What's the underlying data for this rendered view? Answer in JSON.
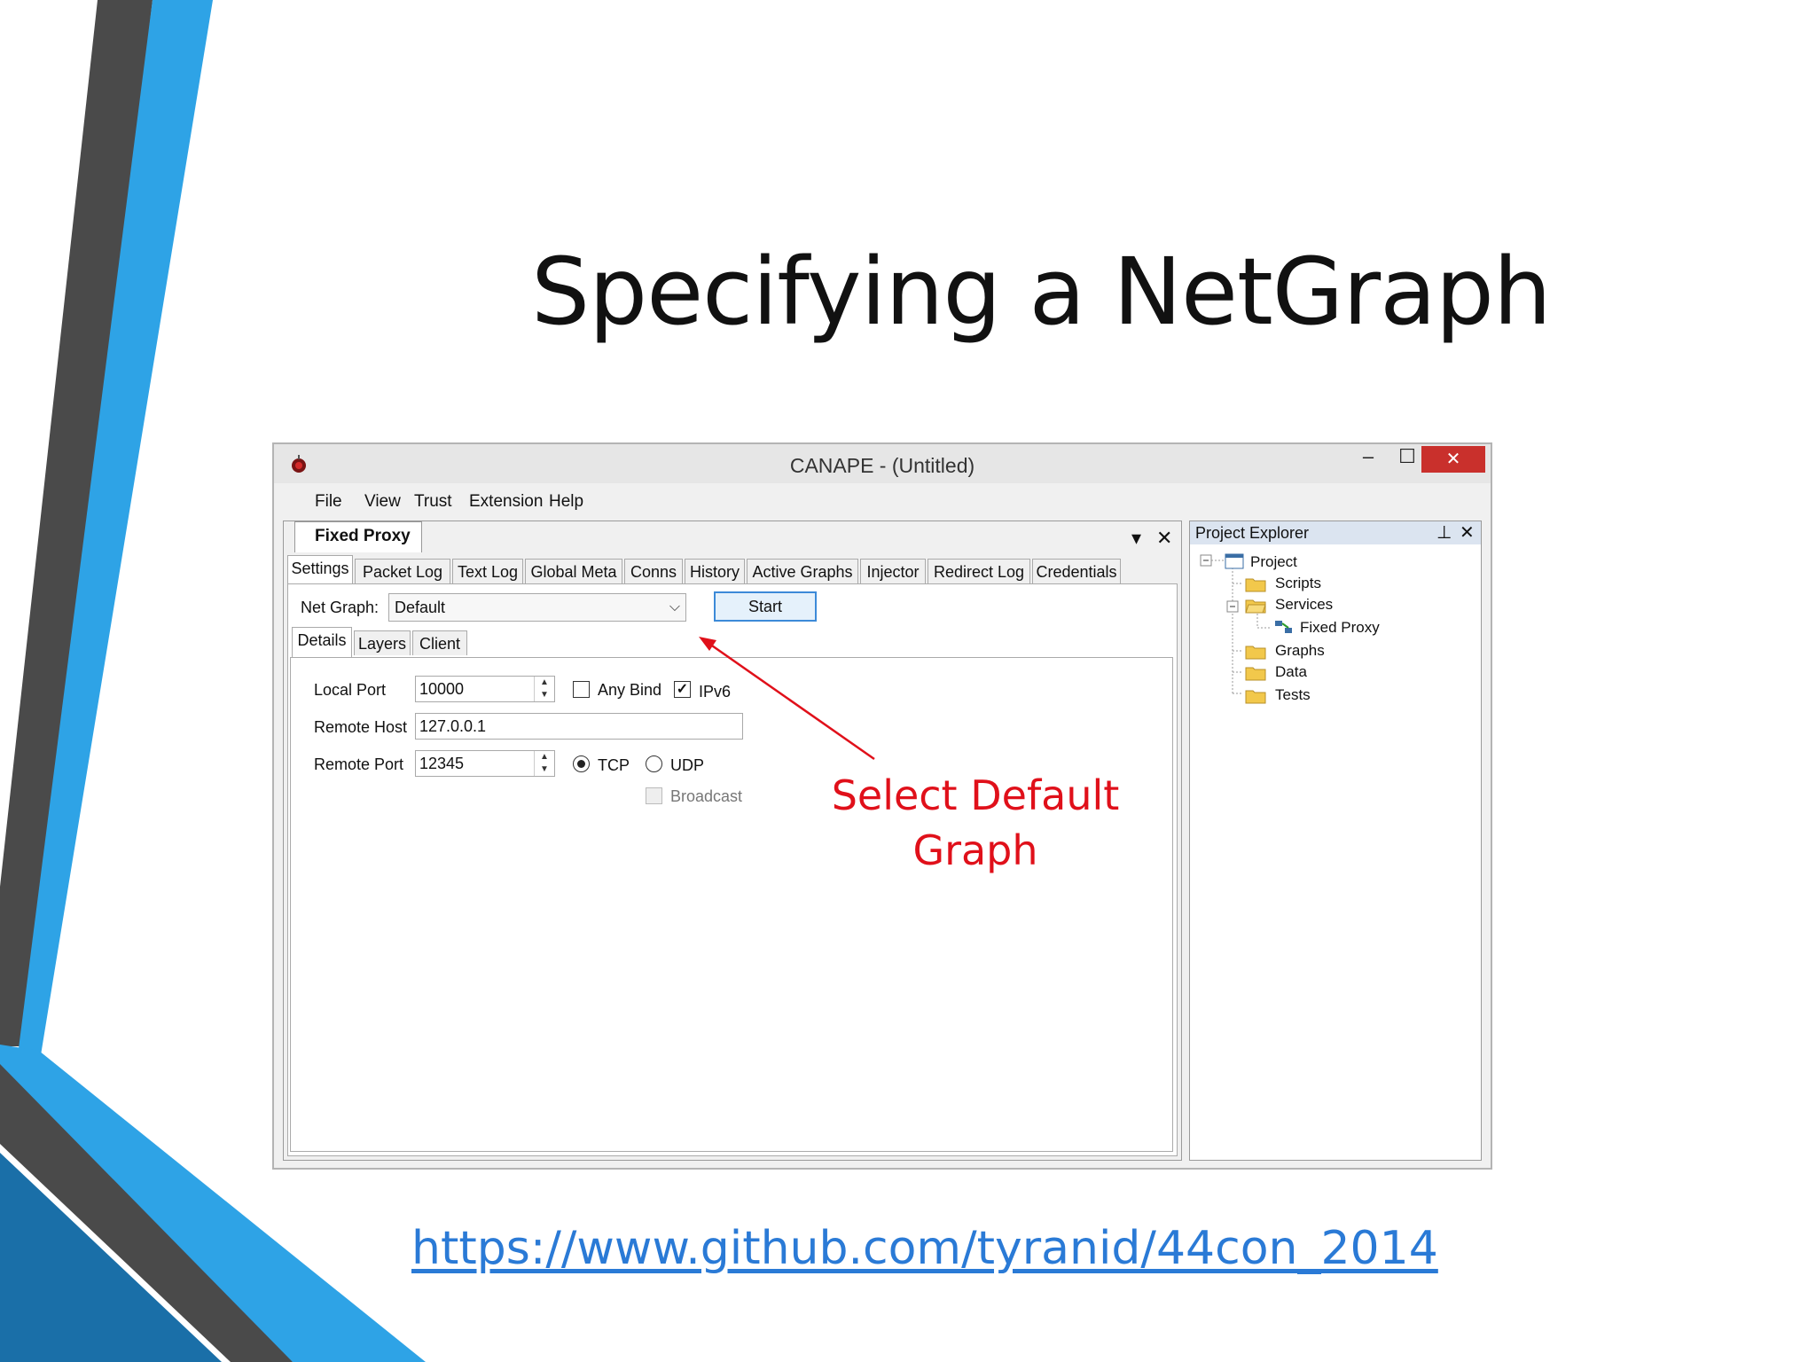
{
  "slide": {
    "title": "Specifying a NetGraph",
    "link": "https://www.github.com/tyranid/44con_2014",
    "annotation_line1": "Select Default",
    "annotation_line2": "Graph"
  },
  "window": {
    "title": "CANAPE - (Untitled)",
    "min_glyph": "–",
    "max_glyph": "☐",
    "close_glyph": "✕"
  },
  "menu": [
    "File",
    "View",
    "Trust",
    "Extension",
    "Help"
  ],
  "document": {
    "tab_label": "Fixed Proxy",
    "dropdown_glyph": "▾",
    "close_glyph": "✕",
    "tabs": [
      "Settings",
      "Packet Log",
      "Text Log",
      "Global Meta",
      "Conns",
      "History",
      "Active Graphs",
      "Injector",
      "Redirect Log",
      "Credentials"
    ],
    "net_graph_label": "Net Graph:",
    "net_graph_value": "Default",
    "start_label": "Start",
    "subtabs": [
      "Details",
      "Layers",
      "Client"
    ],
    "local_port_label": "Local Port",
    "local_port_value": "10000",
    "any_bind_label": "Any Bind",
    "ipv6_label": "IPv6",
    "remote_host_label": "Remote Host",
    "remote_host_value": "127.0.0.1",
    "remote_port_label": "Remote Port",
    "remote_port_value": "12345",
    "tcp_label": "TCP",
    "udp_label": "UDP",
    "broadcast_label": "Broadcast",
    "check_glyph": "✓"
  },
  "explorer": {
    "title": "Project Explorer",
    "pin_glyph": "⊥",
    "close_glyph": "✕",
    "tree": {
      "project": "Project",
      "scripts": "Scripts",
      "services": "Services",
      "fixed_proxy": "Fixed Proxy",
      "graphs": "Graphs",
      "data": "Data",
      "tests": "Tests"
    }
  },
  "colors": {
    "accent_blue": "#2ea3e6",
    "dark_stripe": "#4a4a4a",
    "annotation_red": "#e0101a",
    "close_red": "#c9302c"
  }
}
